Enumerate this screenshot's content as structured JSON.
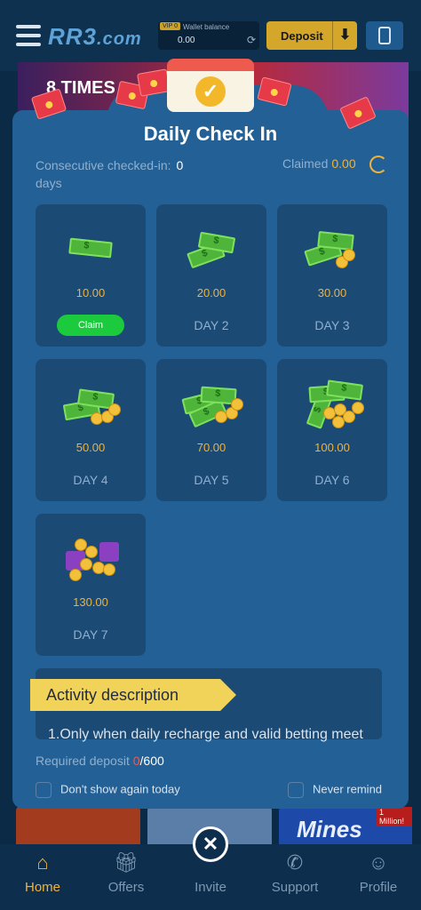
{
  "header": {
    "logo": "RR3",
    "logo_suffix": ".com",
    "vip_badge": "VIP 0",
    "wallet_label": "Wallet balance",
    "wallet_value": "0.00",
    "deposit_label": "Deposit"
  },
  "banner": {
    "text": "8 TIMES"
  },
  "modal": {
    "title": "Daily Check In",
    "consecutive_label": "Consecutive checked-in:",
    "consecutive_value": "0",
    "consecutive_unit": "days",
    "claimed_label": "Claimed",
    "claimed_value": "0.00",
    "days": [
      {
        "amount": "10.00",
        "label": "Claim"
      },
      {
        "amount": "20.00",
        "label": "DAY 2"
      },
      {
        "amount": "30.00",
        "label": "DAY 3"
      },
      {
        "amount": "50.00",
        "label": "DAY 4"
      },
      {
        "amount": "70.00",
        "label": "DAY 5"
      },
      {
        "amount": "100.00",
        "label": "DAY 6"
      },
      {
        "amount": "130.00",
        "label": "DAY 7"
      }
    ],
    "activity_title": "Activity description",
    "activity_text": "1.Only when daily recharge and valid betting meet",
    "required_label": "Required deposit",
    "required_current": "0",
    "required_max": "/600",
    "dont_show_label": "Don't show again today",
    "never_remind_label": "Never remind"
  },
  "games": {
    "badge": "1 Million!",
    "mines_label": "Mines"
  },
  "nav": {
    "items": [
      {
        "label": "Home",
        "icon": "home-icon"
      },
      {
        "label": "Offers",
        "icon": "gift-icon"
      },
      {
        "label": "Invite",
        "icon": "invite-icon"
      },
      {
        "label": "Support",
        "icon": "phone-icon"
      },
      {
        "label": "Profile",
        "icon": "profile-icon"
      }
    ]
  },
  "colors": {
    "accent": "#f0b23a",
    "modal_bg": "#236096",
    "card_bg": "#1b4a75",
    "claim_green": "#1ccb3d"
  }
}
